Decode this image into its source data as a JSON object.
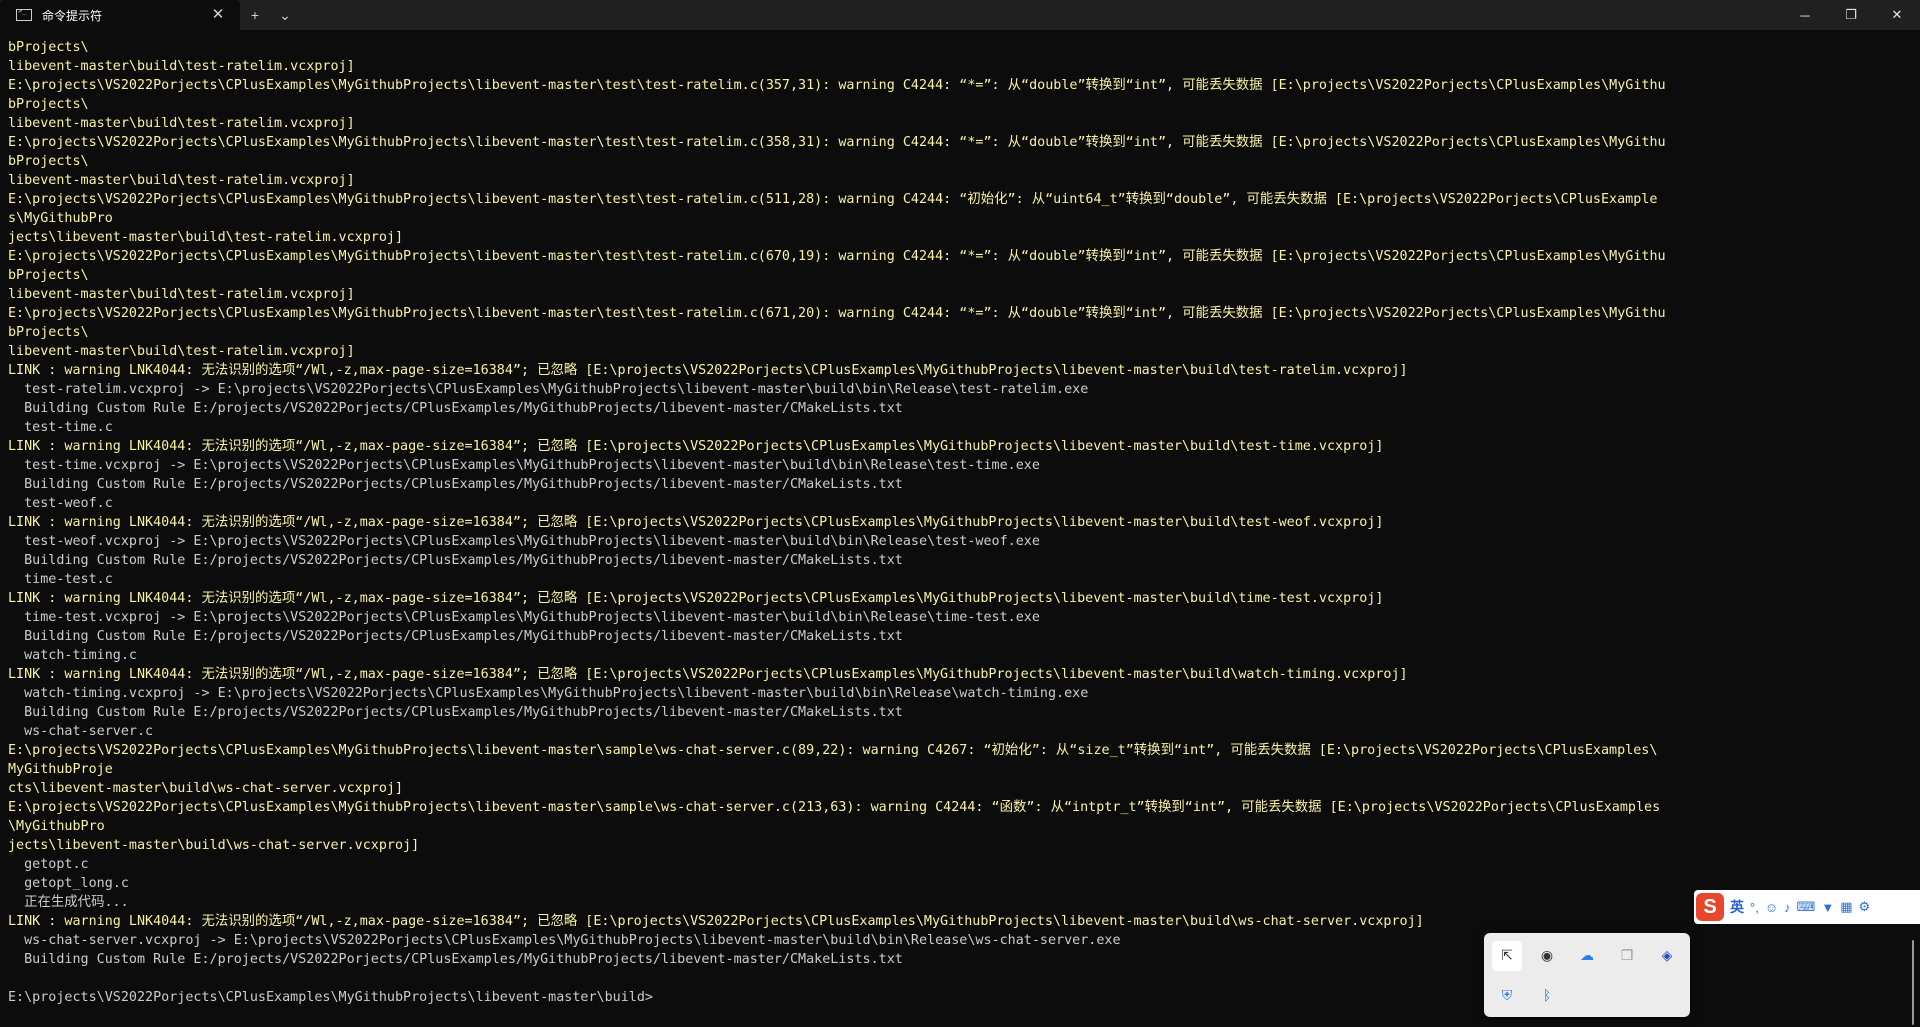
{
  "window": {
    "tab_title": "命令提示符",
    "tab_close": "✕",
    "new_tab": "+",
    "dropdown": "⌄",
    "minimize": "─",
    "maximize": "❐",
    "close": "✕"
  },
  "console_lines": [
    {
      "text": "bProjects\\",
      "warn": true
    },
    {
      "text": "libevent-master\\build\\test-ratelim.vcxproj]",
      "warn": true
    },
    {
      "text": "E:\\projects\\VS2022Porjects\\CPlusExamples\\MyGithubProjects\\libevent-master\\test\\test-ratelim.c(357,31): warning C4244: “*=”: 从“double”转换到“int”, 可能丢失数据 [E:\\projects\\VS2022Porjects\\CPlusExamples\\MyGithu",
      "warn": true
    },
    {
      "text": "bProjects\\",
      "warn": true
    },
    {
      "text": "libevent-master\\build\\test-ratelim.vcxproj]",
      "warn": true
    },
    {
      "text": "E:\\projects\\VS2022Porjects\\CPlusExamples\\MyGithubProjects\\libevent-master\\test\\test-ratelim.c(358,31): warning C4244: “*=”: 从“double”转换到“int”, 可能丢失数据 [E:\\projects\\VS2022Porjects\\CPlusExamples\\MyGithu",
      "warn": true
    },
    {
      "text": "bProjects\\",
      "warn": true
    },
    {
      "text": "libevent-master\\build\\test-ratelim.vcxproj]",
      "warn": true
    },
    {
      "text": "E:\\projects\\VS2022Porjects\\CPlusExamples\\MyGithubProjects\\libevent-master\\test\\test-ratelim.c(511,28): warning C4244: “初始化”: 从“uint64_t”转换到“double”, 可能丢失数据 [E:\\projects\\VS2022Porjects\\CPlusExample",
      "warn": true
    },
    {
      "text": "s\\MyGithubPro",
      "warn": true
    },
    {
      "text": "jects\\libevent-master\\build\\test-ratelim.vcxproj]",
      "warn": true
    },
    {
      "text": "E:\\projects\\VS2022Porjects\\CPlusExamples\\MyGithubProjects\\libevent-master\\test\\test-ratelim.c(670,19): warning C4244: “*=”: 从“double”转换到“int”, 可能丢失数据 [E:\\projects\\VS2022Porjects\\CPlusExamples\\MyGithu",
      "warn": true
    },
    {
      "text": "bProjects\\",
      "warn": true
    },
    {
      "text": "libevent-master\\build\\test-ratelim.vcxproj]",
      "warn": true
    },
    {
      "text": "E:\\projects\\VS2022Porjects\\CPlusExamples\\MyGithubProjects\\libevent-master\\test\\test-ratelim.c(671,20): warning C4244: “*=”: 从“double”转换到“int”, 可能丢失数据 [E:\\projects\\VS2022Porjects\\CPlusExamples\\MyGithu",
      "warn": true
    },
    {
      "text": "bProjects\\",
      "warn": true
    },
    {
      "text": "libevent-master\\build\\test-ratelim.vcxproj]",
      "warn": true
    },
    {
      "text": "LINK : warning LNK4044: 无法识别的选项“/Wl,-z,max-page-size=16384”; 已忽略 [E:\\projects\\VS2022Porjects\\CPlusExamples\\MyGithubProjects\\libevent-master\\build\\test-ratelim.vcxproj]",
      "warn": true
    },
    {
      "text": "  test-ratelim.vcxproj -> E:\\projects\\VS2022Porjects\\CPlusExamples\\MyGithubProjects\\libevent-master\\build\\bin\\Release\\test-ratelim.exe",
      "warn": false
    },
    {
      "text": "  Building Custom Rule E:/projects/VS2022Porjects/CPlusExamples/MyGithubProjects/libevent-master/CMakeLists.txt",
      "warn": false
    },
    {
      "text": "  test-time.c",
      "warn": false
    },
    {
      "text": "LINK : warning LNK4044: 无法识别的选项“/Wl,-z,max-page-size=16384”; 已忽略 [E:\\projects\\VS2022Porjects\\CPlusExamples\\MyGithubProjects\\libevent-master\\build\\test-time.vcxproj]",
      "warn": true
    },
    {
      "text": "  test-time.vcxproj -> E:\\projects\\VS2022Porjects\\CPlusExamples\\MyGithubProjects\\libevent-master\\build\\bin\\Release\\test-time.exe",
      "warn": false
    },
    {
      "text": "  Building Custom Rule E:/projects/VS2022Porjects/CPlusExamples/MyGithubProjects/libevent-master/CMakeLists.txt",
      "warn": false
    },
    {
      "text": "  test-weof.c",
      "warn": false
    },
    {
      "text": "LINK : warning LNK4044: 无法识别的选项“/Wl,-z,max-page-size=16384”; 已忽略 [E:\\projects\\VS2022Porjects\\CPlusExamples\\MyGithubProjects\\libevent-master\\build\\test-weof.vcxproj]",
      "warn": true
    },
    {
      "text": "  test-weof.vcxproj -> E:\\projects\\VS2022Porjects\\CPlusExamples\\MyGithubProjects\\libevent-master\\build\\bin\\Release\\test-weof.exe",
      "warn": false
    },
    {
      "text": "  Building Custom Rule E:/projects/VS2022Porjects/CPlusExamples/MyGithubProjects/libevent-master/CMakeLists.txt",
      "warn": false
    },
    {
      "text": "  time-test.c",
      "warn": false
    },
    {
      "text": "LINK : warning LNK4044: 无法识别的选项“/Wl,-z,max-page-size=16384”; 已忽略 [E:\\projects\\VS2022Porjects\\CPlusExamples\\MyGithubProjects\\libevent-master\\build\\time-test.vcxproj]",
      "warn": true
    },
    {
      "text": "  time-test.vcxproj -> E:\\projects\\VS2022Porjects\\CPlusExamples\\MyGithubProjects\\libevent-master\\build\\bin\\Release\\time-test.exe",
      "warn": false
    },
    {
      "text": "  Building Custom Rule E:/projects/VS2022Porjects/CPlusExamples/MyGithubProjects/libevent-master/CMakeLists.txt",
      "warn": false
    },
    {
      "text": "  watch-timing.c",
      "warn": false
    },
    {
      "text": "LINK : warning LNK4044: 无法识别的选项“/Wl,-z,max-page-size=16384”; 已忽略 [E:\\projects\\VS2022Porjects\\CPlusExamples\\MyGithubProjects\\libevent-master\\build\\watch-timing.vcxproj]",
      "warn": true
    },
    {
      "text": "  watch-timing.vcxproj -> E:\\projects\\VS2022Porjects\\CPlusExamples\\MyGithubProjects\\libevent-master\\build\\bin\\Release\\watch-timing.exe",
      "warn": false
    },
    {
      "text": "  Building Custom Rule E:/projects/VS2022Porjects/CPlusExamples/MyGithubProjects/libevent-master/CMakeLists.txt",
      "warn": false
    },
    {
      "text": "  ws-chat-server.c",
      "warn": false
    },
    {
      "text": "E:\\projects\\VS2022Porjects\\CPlusExamples\\MyGithubProjects\\libevent-master\\sample\\ws-chat-server.c(89,22): warning C4267: “初始化”: 从“size_t”转换到“int”, 可能丢失数据 [E:\\projects\\VS2022Porjects\\CPlusExamples\\",
      "warn": true
    },
    {
      "text": "MyGithubProje",
      "warn": true
    },
    {
      "text": "cts\\libevent-master\\build\\ws-chat-server.vcxproj]",
      "warn": true
    },
    {
      "text": "E:\\projects\\VS2022Porjects\\CPlusExamples\\MyGithubProjects\\libevent-master\\sample\\ws-chat-server.c(213,63): warning C4244: “函数”: 从“intptr_t”转换到“int”, 可能丢失数据 [E:\\projects\\VS2022Porjects\\CPlusExamples",
      "warn": true
    },
    {
      "text": "\\MyGithubPro",
      "warn": true
    },
    {
      "text": "jects\\libevent-master\\build\\ws-chat-server.vcxproj]",
      "warn": true
    },
    {
      "text": "  getopt.c",
      "warn": false
    },
    {
      "text": "  getopt_long.c",
      "warn": false
    },
    {
      "text": "  正在生成代码...",
      "warn": false
    },
    {
      "text": "LINK : warning LNK4044: 无法识别的选项“/Wl,-z,max-page-size=16384”; 已忽略 [E:\\projects\\VS2022Porjects\\CPlusExamples\\MyGithubProjects\\libevent-master\\build\\ws-chat-server.vcxproj]",
      "warn": true
    },
    {
      "text": "  ws-chat-server.vcxproj -> E:\\projects\\VS2022Porjects\\CPlusExamples\\MyGithubProjects\\libevent-master\\build\\bin\\Release\\ws-chat-server.exe",
      "warn": false
    },
    {
      "text": "  Building Custom Rule E:/projects/VS2022Porjects/CPlusExamples/MyGithubProjects/libevent-master/CMakeLists.txt",
      "warn": false
    },
    {
      "text": "",
      "warn": false
    },
    {
      "text": "E:\\projects\\VS2022Porjects\\CPlusExamples\\MyGithubProjects\\libevent-master\\build>",
      "warn": false
    }
  ],
  "colors": {
    "background": "#0c0c0c",
    "text": "#cccccc",
    "warning": "#f9f1a5"
  },
  "ime": {
    "logo": "S",
    "language": "英",
    "icons": [
      "punctuation-icon",
      "emoji-icon",
      "microphone-icon",
      "keyboard-icon",
      "skin-icon",
      "toolbox-icon",
      "settings-icon"
    ]
  },
  "tray_icons": [
    "remote-desktop-icon",
    "audio-icon",
    "cloud-sync-icon",
    "window-icon",
    "app-icon",
    "security-icon",
    "bluetooth-icon"
  ]
}
